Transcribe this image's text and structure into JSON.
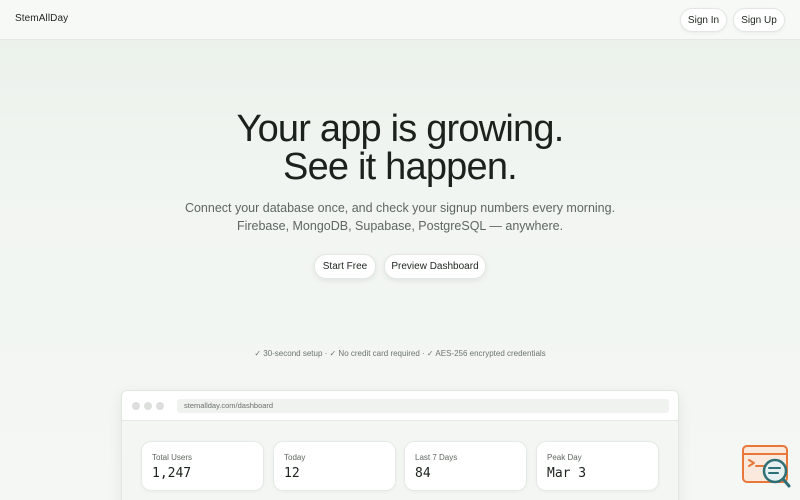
{
  "nav": {
    "brand": "StemAllDay",
    "signin_label": "Sign In",
    "signup_label": "Sign Up"
  },
  "hero": {
    "title_line1": "Your app is growing.",
    "title_line2": "See it happen.",
    "subtitle_line1": "Connect your database once, and check your signup numbers every morning.",
    "subtitle_line2": "Firebase, MongoDB, Supabase, PostgreSQL — anywhere.",
    "cta_start": "Start Free",
    "cta_preview": "Preview Dashboard"
  },
  "trust": {
    "text": "✓ 30-second setup · ✓ No credit card required · ✓ AES-256 encrypted credentials"
  },
  "preview": {
    "url": "stemallday.com/dashboard",
    "stats": [
      {
        "label": "Total Users",
        "value": "1,247"
      },
      {
        "label": "Today",
        "value": "12"
      },
      {
        "label": "Last 7 Days",
        "value": "84"
      },
      {
        "label": "Peak Day",
        "value": "Mar 3"
      }
    ]
  },
  "widget": {
    "icon": "help-search-icon",
    "accent_color": "#e8773a",
    "secondary_color": "#2f6f78"
  }
}
